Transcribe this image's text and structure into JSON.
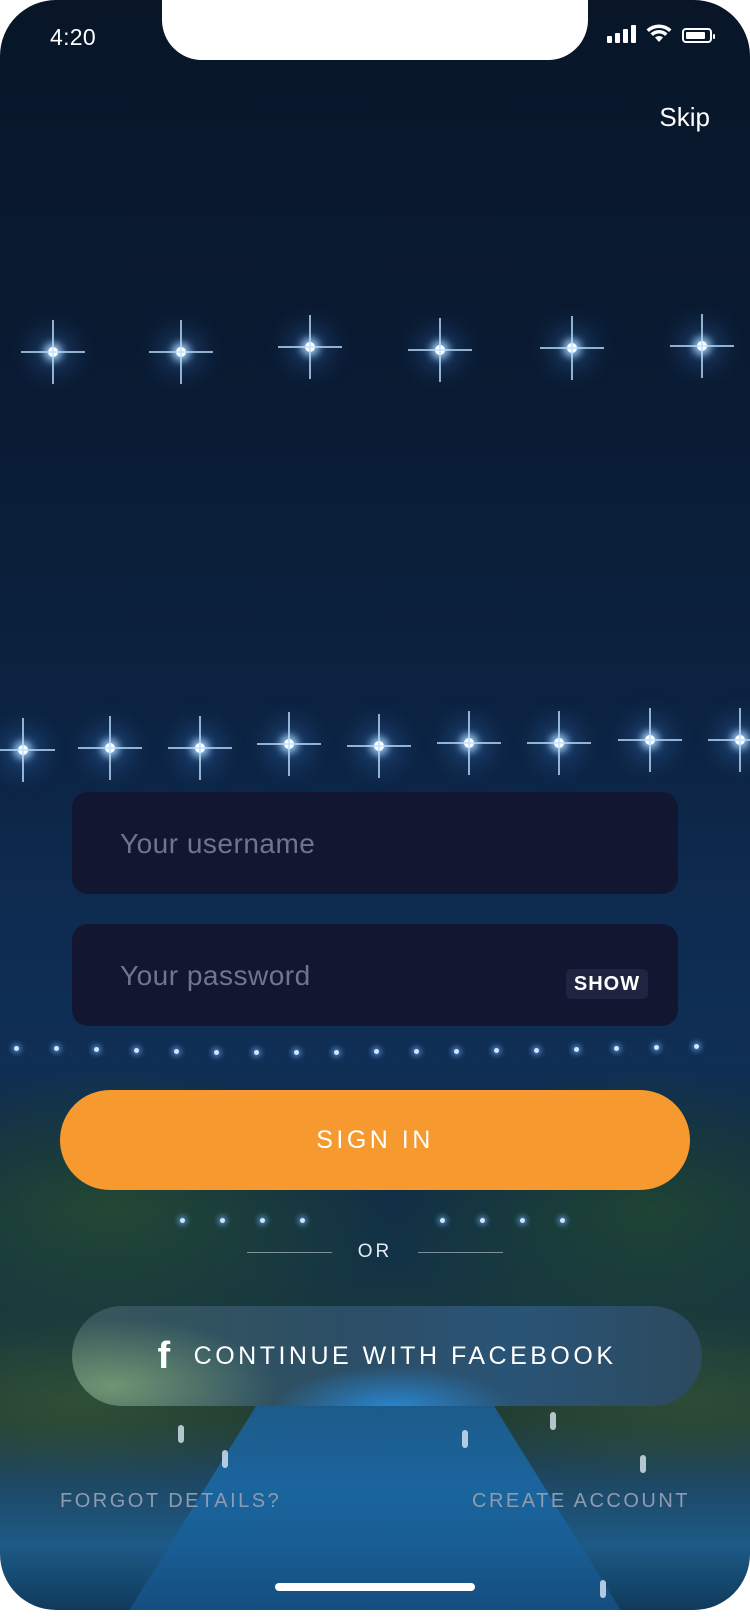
{
  "status_bar": {
    "time": "4:20",
    "signal_icon": "cellular-signal-icon",
    "wifi_icon": "wifi-icon",
    "battery_icon": "battery-icon",
    "battery_level": 0.85
  },
  "header": {
    "skip_label": "Skip"
  },
  "form": {
    "username_placeholder": "Your username",
    "password_placeholder": "Your password",
    "show_label": "SHOW"
  },
  "actions": {
    "sign_in_label": "SIGN IN",
    "or_label": "OR",
    "facebook_icon": "facebook-f-icon",
    "facebook_label": "CONTINUE WITH FACEBOOK",
    "forgot_label": "FORGOT DETAILS?",
    "create_account_label": "CREATE ACCOUNT"
  },
  "colors": {
    "accent": "#f6992e",
    "field_background": "#121631",
    "background_top": "#081628"
  }
}
